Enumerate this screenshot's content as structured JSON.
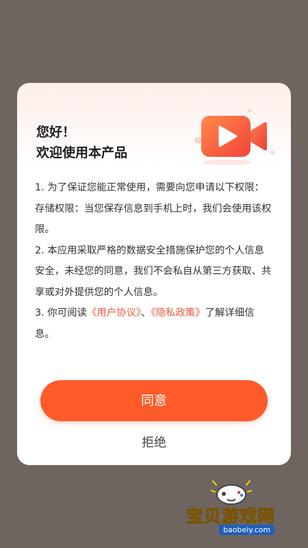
{
  "dialog": {
    "greeting_line1": "您好！",
    "greeting_line2": "欢迎使用本产品",
    "hero_icon": "video-camera-icon",
    "paragraphs": {
      "p1": "1. 为了保证您能正常使用，需要向您申请以下权限：存储权限：当您保存信息到手机上时，我们会使用该权限。",
      "p2": "2. 本应用采取严格的数据安全措施保护您的个人信息安全，未经您的同意，我们不会私自从第三方获取、共享或对外提供您的个人信息。",
      "p3_prefix": "3. 你可阅读",
      "user_agreement_link": "《用户协议》",
      "p3_separator": "、",
      "privacy_policy_link": "《隐私政策》",
      "p3_suffix": "了解详细信息。"
    },
    "agree_label": "同意",
    "reject_label": "拒绝"
  },
  "watermark": {
    "text": "宝贝游戏网",
    "url": "baobeiy.com"
  },
  "colors": {
    "overlay": "#6e6561",
    "accent": "#ff5a2a",
    "link": "#f25a3c"
  }
}
